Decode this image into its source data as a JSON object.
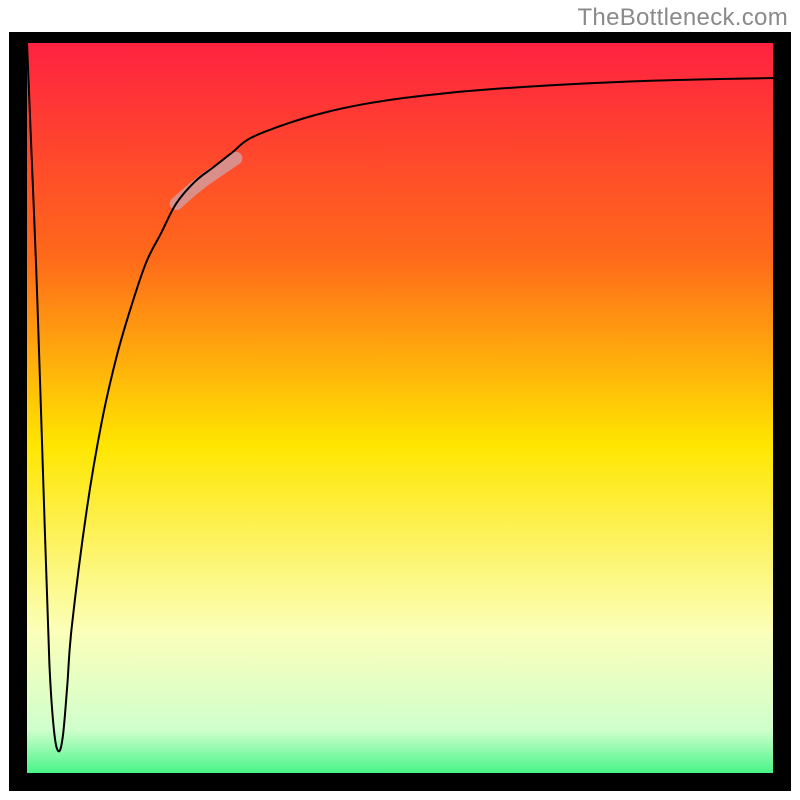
{
  "watermark": "TheBottleneck.com",
  "chart_data": {
    "type": "line",
    "title": "",
    "subtitle": "",
    "xlabel": "",
    "ylabel": "",
    "xlim": [
      0,
      100
    ],
    "ylim": [
      0,
      100
    ],
    "grid": false,
    "legend": false,
    "background_gradient": {
      "top": "#ff1f42",
      "upper_mid": "#ff7a00",
      "mid": "#ffe600",
      "lower_mid": "#fbffba",
      "bottom": "#2bf27a"
    },
    "series": [
      {
        "name": "main-curve",
        "color": "#000000",
        "stroke_width": 2,
        "x": [
          0.0,
          0.6,
          1.2,
          1.8,
          2.4,
          3.0,
          3.6,
          4.2,
          4.8,
          5.4,
          6.0,
          8,
          10,
          12,
          14,
          16,
          18,
          20,
          22.5,
          25,
          27.5,
          30,
          35,
          40,
          45,
          50,
          55,
          60,
          70,
          80,
          90,
          100
        ],
        "values": [
          100,
          85,
          70,
          52,
          33,
          15,
          6,
          3,
          5,
          12,
          20,
          36,
          48,
          57,
          64,
          70,
          74,
          78,
          81,
          83,
          85,
          87,
          89,
          90.5,
          91.6,
          92.4,
          93,
          93.5,
          94.2,
          94.7,
          95,
          95.2
        ]
      },
      {
        "name": "highlight-segment",
        "color": "#d49a9a",
        "stroke_width": 13,
        "opacity": 0.85,
        "x": [
          20,
          22,
          24,
          26,
          28
        ],
        "values": [
          78,
          79.8,
          81.4,
          82.8,
          84.2
        ]
      }
    ]
  }
}
